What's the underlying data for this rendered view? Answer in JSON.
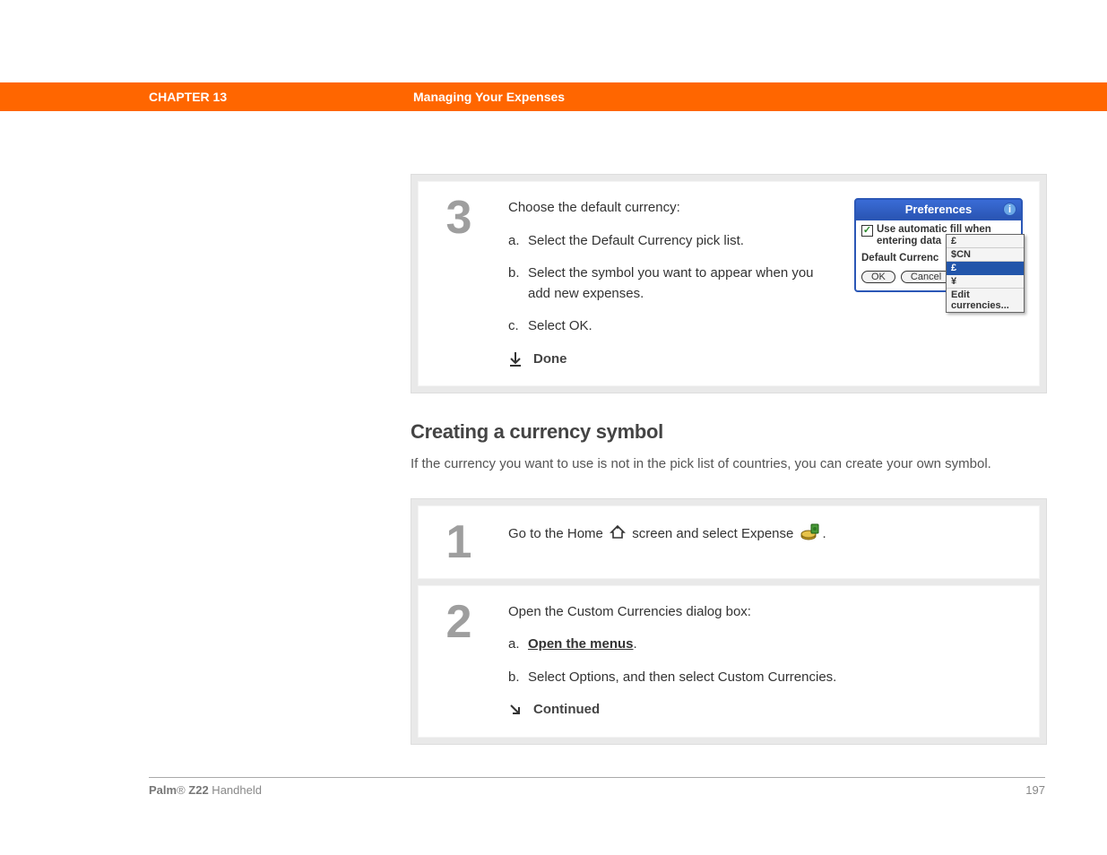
{
  "header": {
    "chapter": "CHAPTER 13",
    "title": "Managing Your Expenses"
  },
  "step3": {
    "num": "3",
    "intro": "Choose the default currency:",
    "a_letter": "a.",
    "a_text": "Select the Default Currency pick list.",
    "b_letter": "b.",
    "b_text": "Select the symbol you want to appear when you add new expenses.",
    "c_letter": "c.",
    "c_text": "Select OK.",
    "done": "Done",
    "dialog": {
      "title": "Preferences",
      "checkbox_label": "Use automatic fill when entering data",
      "default_label": "Default Currenc",
      "ok": "OK",
      "cancel": "Cancel",
      "dd_pound": "£",
      "dd_scn": "$CN",
      "dd_pound2": "£",
      "dd_yen": "¥",
      "dd_edit": "Edit currencies..."
    }
  },
  "section": {
    "heading": "Creating a currency symbol",
    "para": "If the currency you want to use is not in the pick list of countries, you can create your own symbol."
  },
  "step1": {
    "num": "1",
    "pre": "Go to the Home",
    "mid": "screen and select Expense",
    "post": "."
  },
  "step2": {
    "num": "2",
    "intro": "Open the Custom Currencies dialog box:",
    "a_letter": "a.",
    "a_link": "Open the menus",
    "a_suffix": ".",
    "b_letter": "b.",
    "b_text": "Select Options, and then select Custom Currencies.",
    "continued": "Continued"
  },
  "footer": {
    "brand_bold": "Palm",
    "brand_reg": "®",
    "model_bold": " Z22",
    "model_rest": " Handheld",
    "page": "197"
  }
}
